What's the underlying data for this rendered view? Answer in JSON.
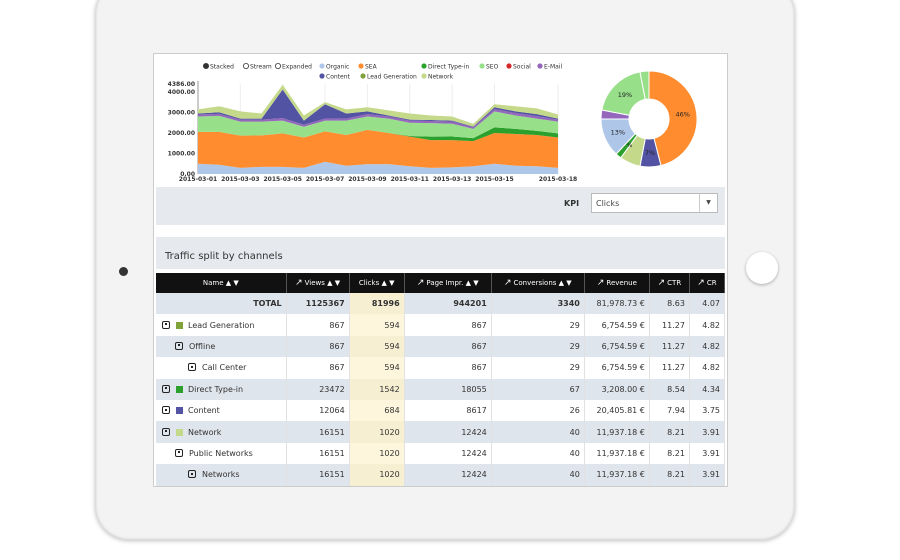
{
  "colors": {
    "Organic": "#aec7e8",
    "SEA": "#ff8c2e",
    "Direct Type-in": "#2ca02c",
    "SEO": "#98df8a",
    "Social": "#d62728",
    "E-Mail": "#9467bd",
    "Content": "#5254a3",
    "Lead Generation": "#7fa23a",
    "Network": "#c5d98a"
  },
  "chart_data": [
    {
      "type": "area",
      "stacked": true,
      "legend": {
        "modes": [
          "Stacked",
          "Stream",
          "Expanded"
        ],
        "selected_mode": "Stacked",
        "series": [
          "Organic",
          "SEA",
          "Direct Type-in",
          "SEO",
          "Social",
          "E-Mail",
          "Content",
          "Lead Generation",
          "Network"
        ],
        "position": "top"
      },
      "x": [
        "2015-03-01",
        "2015-03-02",
        "2015-03-03",
        "2015-03-04",
        "2015-03-05",
        "2015-03-06",
        "2015-03-07",
        "2015-03-08",
        "2015-03-09",
        "2015-03-10",
        "2015-03-11",
        "2015-03-12",
        "2015-03-13",
        "2015-03-14",
        "2015-03-15",
        "2015-03-16",
        "2015-03-17",
        "2015-03-18"
      ],
      "x_ticks": [
        "2015-03-01",
        "2015-03-03",
        "2015-03-05",
        "2015-03-07",
        "2015-03-09",
        "2015-03-11",
        "2015-03-13",
        "2015-03-15",
        "2015-03-18"
      ],
      "y_ticks": [
        "0.00",
        "1000.00",
        "2000.00",
        "3000.00",
        "4000.00",
        "4386.00"
      ],
      "ylim": [
        0,
        4386
      ],
      "series": [
        {
          "name": "Organic",
          "values": [
            500,
            450,
            300,
            350,
            350,
            300,
            600,
            400,
            480,
            480,
            380,
            300,
            320,
            380,
            500,
            400,
            380,
            300
          ]
        },
        {
          "name": "SEA",
          "values": [
            1550,
            1600,
            1570,
            1530,
            1630,
            1480,
            1480,
            1500,
            1670,
            1520,
            1440,
            1350,
            1330,
            1220,
            1500,
            1550,
            1520,
            1480
          ]
        },
        {
          "name": "Direct Type-in",
          "values": [
            0,
            0,
            0,
            0,
            0,
            0,
            0,
            0,
            0,
            0,
            30,
            170,
            180,
            150,
            270,
            250,
            200,
            200
          ]
        },
        {
          "name": "SEO",
          "values": [
            750,
            780,
            680,
            670,
            620,
            520,
            520,
            700,
            650,
            700,
            650,
            660,
            620,
            450,
            780,
            650,
            600,
            570
          ]
        },
        {
          "name": "E-Mail",
          "values": [
            100,
            100,
            100,
            100,
            120,
            100,
            100,
            100,
            120,
            100,
            100,
            100,
            100,
            80,
            120,
            120,
            120,
            100
          ]
        },
        {
          "name": "Content",
          "values": [
            50,
            80,
            50,
            50,
            1400,
            200,
            700,
            250,
            130,
            50,
            50,
            50,
            50,
            30,
            80,
            80,
            100,
            50
          ]
        },
        {
          "name": "Network",
          "values": [
            200,
            290,
            350,
            250,
            230,
            250,
            100,
            200,
            200,
            250,
            300,
            220,
            200,
            140,
            150,
            250,
            280,
            200
          ]
        }
      ]
    },
    {
      "type": "pie",
      "donut": true,
      "slices": [
        {
          "name": "SEA",
          "value": 46,
          "label": "46%"
        },
        {
          "name": "Content",
          "value": 7,
          "label": "7%"
        },
        {
          "name": "Network",
          "value": 7,
          "label": ""
        },
        {
          "name": "Direct Type-in",
          "value": 2,
          "label": "7%"
        },
        {
          "name": "Organic",
          "value": 13,
          "label": "13%"
        },
        {
          "name": "E-Mail",
          "value": 3,
          "label": ""
        },
        {
          "name": "SEO",
          "value": 19,
          "label": "19%"
        },
        {
          "name": "SEO",
          "value": 3,
          "label": ""
        }
      ]
    }
  ],
  "kpi": {
    "label": "KPI",
    "selected": "Clicks"
  },
  "table": {
    "title": "Traffic split by channels",
    "headers": [
      "Name ▲ ▼",
      "Views ▲ ▼",
      "Clicks ▲ ▼",
      "Page Impr. ▲ ▼",
      "Conversions ▲ ▼",
      "Revenue",
      "CTR",
      "CR"
    ],
    "total": {
      "name": "TOTAL",
      "cells": [
        "1125367",
        "81996",
        "944201",
        "3340",
        "81,978.73 €",
        "8.63",
        "4.07"
      ]
    },
    "rows": [
      {
        "name": "Lead Generation",
        "level": 0,
        "color": "#7fa23a",
        "cells": [
          "867",
          "594",
          "867",
          "29",
          "6,754.59 €",
          "11.27",
          "4.82"
        ]
      },
      {
        "name": "Offline",
        "level": 1,
        "cells": [
          "867",
          "594",
          "867",
          "29",
          "6,754.59 €",
          "11.27",
          "4.82"
        ]
      },
      {
        "name": "Call Center",
        "level": 2,
        "cells": [
          "867",
          "594",
          "867",
          "29",
          "6,754.59 €",
          "11.27",
          "4.82"
        ]
      },
      {
        "name": "Direct Type-in",
        "level": 0,
        "color": "#2ca02c",
        "cells": [
          "23472",
          "1542",
          "18055",
          "67",
          "3,208.00 €",
          "8.54",
          "4.34"
        ]
      },
      {
        "name": "Content",
        "level": 0,
        "color": "#5254a3",
        "cells": [
          "12064",
          "684",
          "8617",
          "26",
          "20,405.81 €",
          "7.94",
          "3.75"
        ]
      },
      {
        "name": "Network",
        "level": 0,
        "color": "#c5d98a",
        "cells": [
          "16151",
          "1020",
          "12424",
          "40",
          "11,937.18 €",
          "8.21",
          "3.91"
        ]
      },
      {
        "name": "Public Networks",
        "level": 1,
        "cells": [
          "16151",
          "1020",
          "12424",
          "40",
          "11,937.18 €",
          "8.21",
          "3.91"
        ]
      },
      {
        "name": "Networks",
        "level": 2,
        "cells": [
          "16151",
          "1020",
          "12424",
          "40",
          "11,937.18 €",
          "8.21",
          "3.91"
        ]
      }
    ]
  }
}
